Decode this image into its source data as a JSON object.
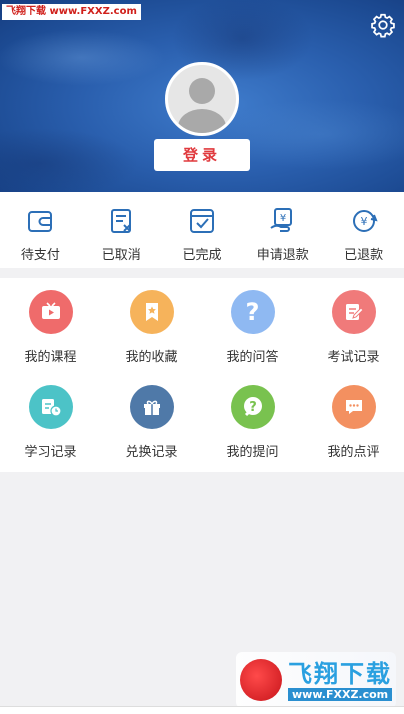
{
  "watermark_top": "飞翔下载 www.FXXZ.com",
  "header": {
    "login_label": "登录",
    "settings_icon": "gear-icon"
  },
  "orders": [
    {
      "label": "待支付",
      "icon": "wallet-icon"
    },
    {
      "label": "已取消",
      "icon": "cancelled-doc-icon"
    },
    {
      "label": "已完成",
      "icon": "completed-check-icon"
    },
    {
      "label": "申请退款",
      "icon": "refund-request-icon"
    },
    {
      "label": "已退款",
      "icon": "refunded-yen-icon"
    }
  ],
  "grid": [
    {
      "label": "我的课程",
      "icon": "video-course-icon",
      "color": "#ef6b6b"
    },
    {
      "label": "我的收藏",
      "icon": "star-bookmark-icon",
      "color": "#f6b35b"
    },
    {
      "label": "我的问答",
      "icon": "question-icon",
      "color": "#8fb9f2"
    },
    {
      "label": "考试记录",
      "icon": "exam-pencil-icon",
      "color": "#f07a7a"
    },
    {
      "label": "学习记录",
      "icon": "study-clock-icon",
      "color": "#4cc3c7"
    },
    {
      "label": "兑换记录",
      "icon": "gift-icon",
      "color": "#4f79a8"
    },
    {
      "label": "我的提问",
      "icon": "question-bubble-icon",
      "color": "#79c24f"
    },
    {
      "label": "我的点评",
      "icon": "comment-icon",
      "color": "#f39060"
    }
  ],
  "watermark_bottom": {
    "title": "飞翔下载",
    "url": "www.FXXZ.com"
  }
}
